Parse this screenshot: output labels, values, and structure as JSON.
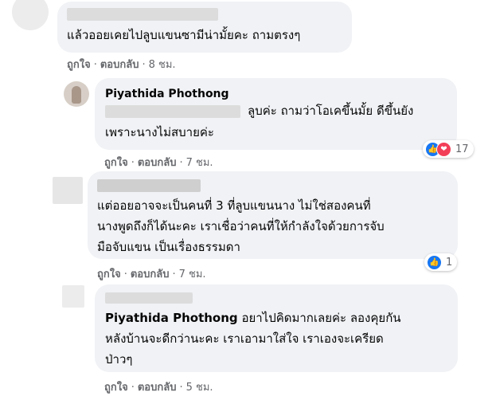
{
  "comments": [
    {
      "text_lines": [
        "แล้วออยเคยไปลูบแขนซามีน่ามั้ยคะ ถามตรงๆ"
      ],
      "actions": {
        "like": "ถูกใจ",
        "reply": "ตอบกลับ",
        "time": "8 ชม."
      }
    },
    {
      "author": "Piyathida Phothong",
      "text_lines": [
        "ลูบค่ะ ถามว่าโอเคขึ้นมั้ย ดีขึ้นยัง",
        "เพราะนางไม่สบายค่ะ"
      ],
      "actions": {
        "like": "ถูกใจ",
        "reply": "ตอบกลับ",
        "time": "7 ชม."
      },
      "reaction_count": "17",
      "reactions": [
        "like-icon",
        "love-icon"
      ]
    },
    {
      "text_lines": [
        "แต่ออยอาจจะเป็นคนที่ 3 ที่ลูบแขนนาง ไม่ใช่สองคนที่",
        "นางพูดถึงก็ได้นะคะ เราเชื่อว่าคนที่ให้กำลังใจด้วยการจับ",
        "มือจับแขน เป็นเรื่องธรรมดา"
      ],
      "actions": {
        "like": "ถูกใจ",
        "reply": "ตอบกลับ",
        "time": "7 ชม."
      },
      "reaction_count": "1",
      "reactions": [
        "like-icon"
      ]
    },
    {
      "author_inline": "Piyathida Phothong",
      "text_lines": [
        "อยาไปคิดมากเลยค่ะ ลองคุยกัน",
        "หลังบ้านจะดีกว่านะคะ เราเอามาใส่ใจ เราเองจะเครียด",
        "ป่าวๆ"
      ],
      "actions": {
        "like": "ถูกใจ",
        "reply": "ตอบกลับ",
        "time": "5 ชม."
      }
    }
  ],
  "colors": {
    "bubble": "#f0f2f5",
    "meta": "#65676b",
    "like": "#1877f2",
    "love": "#f33e58"
  }
}
